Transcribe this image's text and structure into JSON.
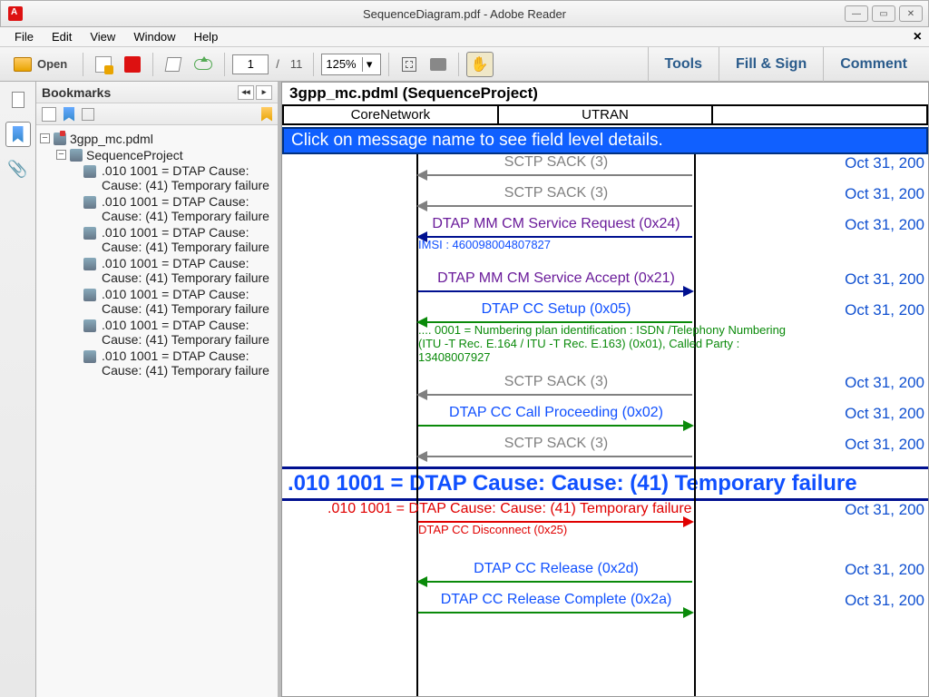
{
  "window": {
    "title": "SequenceDiagram.pdf - Adobe Reader"
  },
  "menubar": {
    "file": "File",
    "edit": "Edit",
    "view": "View",
    "window": "Window",
    "help": "Help"
  },
  "toolbar": {
    "open_label": "Open",
    "page_current": "1",
    "page_sep": "/",
    "page_total": "11",
    "zoom": "125%",
    "tools": "Tools",
    "fill_sign": "Fill & Sign",
    "comment": "Comment"
  },
  "bookmarks": {
    "title": "Bookmarks",
    "root": "3gpp_mc.pdml",
    "project": "SequenceProject",
    "leaf_text": ".010 1001 = DTAP Cause: Cause: (41) Temporary failure"
  },
  "document": {
    "header": "3gpp_mc.pdml (SequenceProject)",
    "col1": "CoreNetwork",
    "col2": "UTRAN",
    "banner": "Click on message name to see field level details.",
    "date": "Oct 31, 200",
    "section_title": ".010 1001 = DTAP Cause: Cause: (41) Temporary failure",
    "messages": {
      "sctp_sack": "SCTP SACK (3)",
      "cm_req": "DTAP MM CM Service Request (0x24)",
      "imsi": "IMSI : 460098004807827",
      "cm_acc": "DTAP MM CM Service Accept (0x21)",
      "cc_setup": "DTAP CC Setup (0x05)",
      "setup_detail": ".... 0001 = Numbering plan identification : ISDN /Telephony Numbering (ITU -T Rec. E.164 / ITU -T Rec. E.163) (0x01), Called Party : 13408007927",
      "cc_proc": "DTAP CC Call Proceeding (0x02)",
      "cause_msg": ".010 1001 = DTAP Cause: Cause: (41) Temporary failure",
      "cc_disc": "DTAP CC Disconnect (0x25)",
      "cc_rel": "DTAP CC Release (0x2d)",
      "cc_rel_c": "DTAP CC Release Complete (0x2a)"
    }
  }
}
